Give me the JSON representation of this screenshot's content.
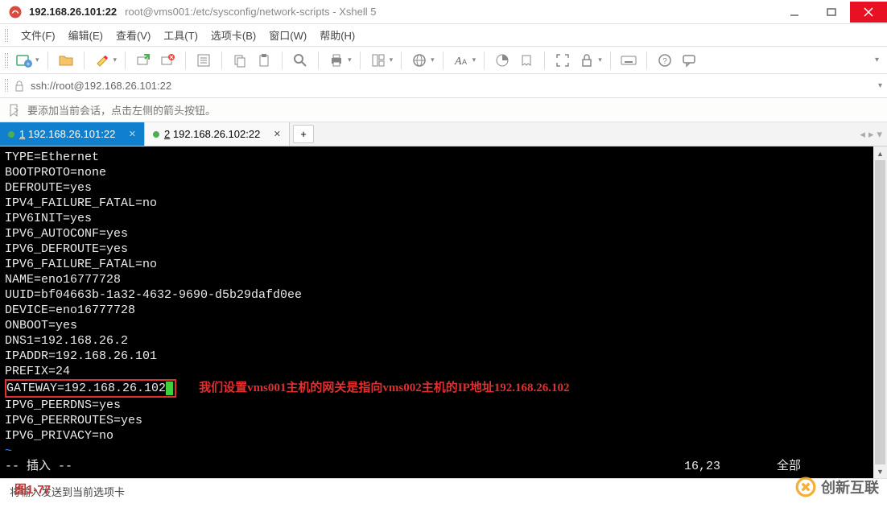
{
  "title": {
    "host": "192.168.26.101:22",
    "path": "root@vms001:/etc/sysconfig/network-scripts - Xshell 5"
  },
  "menu": {
    "file": "文件(F)",
    "edit": "编辑(E)",
    "view": "查看(V)",
    "tools": "工具(T)",
    "tab_card": "选项卡(B)",
    "window": "窗口(W)",
    "help": "帮助(H)"
  },
  "addressbar": {
    "url": "ssh://root@192.168.26.101:22"
  },
  "infobar": {
    "hint": "要添加当前会话，点击左侧的箭头按钮。"
  },
  "tabs": [
    {
      "num": "1",
      "label": "192.168.26.101:22",
      "active": true
    },
    {
      "num": "2",
      "label": "192.168.26.102:22",
      "active": false
    }
  ],
  "terminal_lines": [
    "TYPE=Ethernet",
    "BOOTPROTO=none",
    "DEFROUTE=yes",
    "IPV4_FAILURE_FATAL=no",
    "IPV6INIT=yes",
    "IPV6_AUTOCONF=yes",
    "IPV6_DEFROUTE=yes",
    "IPV6_FAILURE_FATAL=no",
    "NAME=eno16777728",
    "UUID=bf04663b-1a32-4632-9690-d5b29dafd0ee",
    "DEVICE=eno16777728",
    "ONBOOT=yes",
    "DNS1=192.168.26.2",
    "IPADDR=192.168.26.101",
    "PREFIX=24"
  ],
  "gateway_line": "GATEWAY=192.168.26.102",
  "annotation": "我们设置vms001主机的网关是指向vms002主机的IP地址192.168.26.102",
  "after_lines": [
    "IPV6_PEERDNS=yes",
    "IPV6_PEERROUTES=yes",
    "IPV6_PRIVACY=no"
  ],
  "vim_status": {
    "mode": "-- 插入 --",
    "pos": "16,23",
    "scroll": "全部"
  },
  "statusbar": {
    "text": "将输入发送到当前选项卡"
  },
  "figure_label": "图1-77",
  "watermark": "创新互联"
}
